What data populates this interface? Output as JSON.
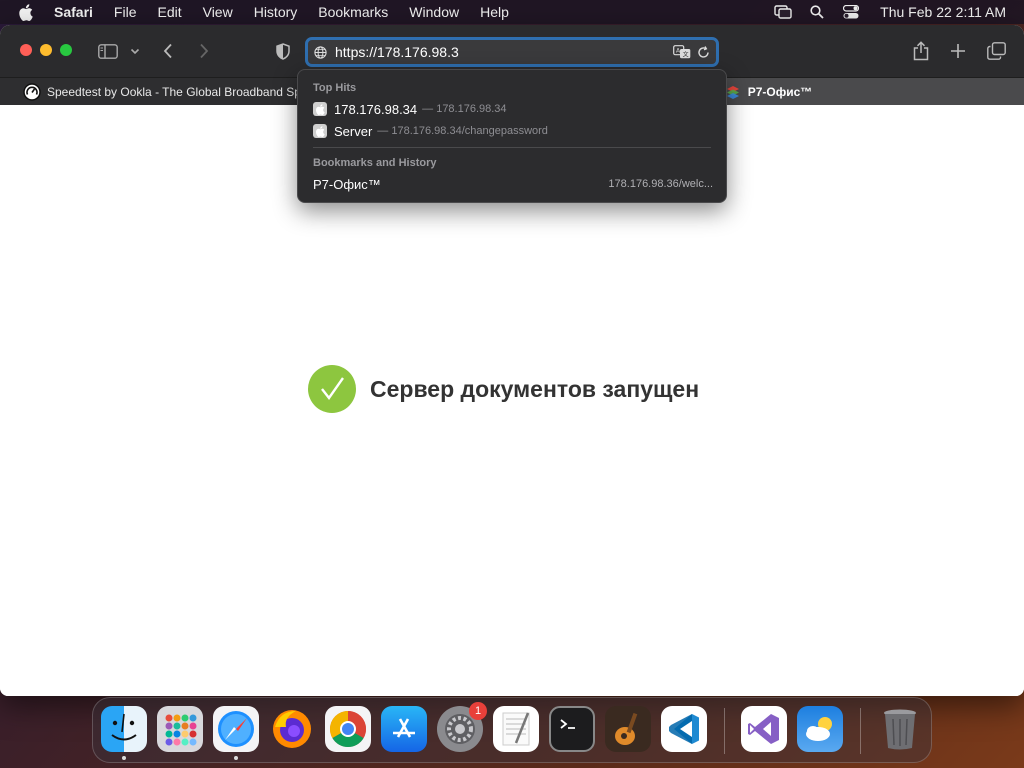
{
  "menubar": {
    "app": "Safari",
    "items": [
      "File",
      "Edit",
      "View",
      "History",
      "Bookmarks",
      "Window",
      "Help"
    ],
    "clock": "Thu Feb 22  2:11 AM"
  },
  "toolbar": {
    "url": "https://178.176.98.3"
  },
  "tabs": [
    {
      "title": "Speedtest by Ookla - The Global Broadband Spee"
    },
    {
      "title": "Р7-Офис™"
    }
  ],
  "dropdown": {
    "top_hits_header": "Top Hits",
    "top_hits": [
      {
        "title": "178.176.98.34",
        "url": "— 178.176.98.34"
      },
      {
        "title": "Server",
        "url": "— 178.176.98.34/changepassword"
      }
    ],
    "history_header": "Bookmarks and History",
    "history": [
      {
        "title": "Р7-Офис™",
        "url": "178.176.98.36/welc..."
      }
    ]
  },
  "page": {
    "status_text": "Сервер документов запущен"
  },
  "dock": {
    "apps": [
      "Finder",
      "Launchpad",
      "Safari",
      "Firefox",
      "Chrome",
      "App Store",
      "System Settings",
      "TextEdit",
      "Terminal",
      "GarageBand",
      "Visual Studio Code",
      "Visual Studio",
      "Weather",
      "Trash"
    ],
    "settings_badge": "1"
  }
}
